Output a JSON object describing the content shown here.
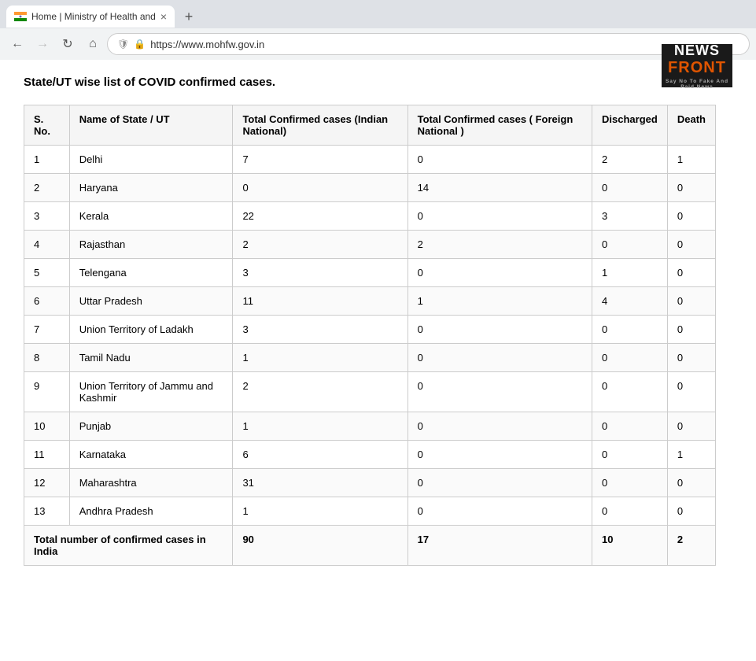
{
  "browser": {
    "tab_title": "Home | Ministry of Health and",
    "tab_close": "×",
    "new_tab": "+",
    "url": "https://www.mohfw.gov.in",
    "back_icon": "←",
    "forward_icon": "→",
    "reload_icon": "↻",
    "home_icon": "⌂"
  },
  "news_logo": {
    "line1": "NEWS",
    "line2": "FRONT",
    "tagline": "Say No To Fake And Paid News"
  },
  "page": {
    "heading": "State/UT wise list of COVID confirmed cases.",
    "columns": [
      "S. No.",
      "Name of State / UT",
      "Total Confirmed cases (Indian National)",
      "Total Confirmed cases ( Foreign National )",
      "Discharged",
      "Death"
    ],
    "rows": [
      {
        "sno": "1",
        "state": "Delhi",
        "indian": "7",
        "foreign": "0",
        "discharged": "2",
        "death": "1"
      },
      {
        "sno": "2",
        "state": "Haryana",
        "indian": "0",
        "foreign": "14",
        "discharged": "0",
        "death": "0"
      },
      {
        "sno": "3",
        "state": "Kerala",
        "indian": "22",
        "foreign": "0",
        "discharged": "3",
        "death": "0"
      },
      {
        "sno": "4",
        "state": "Rajasthan",
        "indian": "2",
        "foreign": "2",
        "discharged": "0",
        "death": "0"
      },
      {
        "sno": "5",
        "state": "Telengana",
        "indian": "3",
        "foreign": "0",
        "discharged": "1",
        "death": "0"
      },
      {
        "sno": "6",
        "state": "Uttar Pradesh",
        "indian": "11",
        "foreign": "1",
        "discharged": "4",
        "death": "0"
      },
      {
        "sno": "7",
        "state": "Union Territory of Ladakh",
        "indian": "3",
        "foreign": "0",
        "discharged": "0",
        "death": "0"
      },
      {
        "sno": "8",
        "state": "Tamil Nadu",
        "indian": "1",
        "foreign": "0",
        "discharged": "0",
        "death": "0"
      },
      {
        "sno": "9",
        "state": "Union Territory of Jammu and Kashmir",
        "indian": "2",
        "foreign": "0",
        "discharged": "0",
        "death": "0"
      },
      {
        "sno": "10",
        "state": "Punjab",
        "indian": "1",
        "foreign": "0",
        "discharged": "0",
        "death": "0"
      },
      {
        "sno": "11",
        "state": "Karnataka",
        "indian": "6",
        "foreign": "0",
        "discharged": "0",
        "death": "1"
      },
      {
        "sno": "12",
        "state": "Maharashtra",
        "indian": "31",
        "foreign": "0",
        "discharged": "0",
        "death": "0"
      },
      {
        "sno": "13",
        "state": "Andhra Pradesh",
        "indian": "1",
        "foreign": "0",
        "discharged": "0",
        "death": "0"
      }
    ],
    "total_label": "Total number of confirmed cases in India",
    "total_indian": "90",
    "total_foreign": "17",
    "total_discharged": "10",
    "total_death": "2"
  }
}
